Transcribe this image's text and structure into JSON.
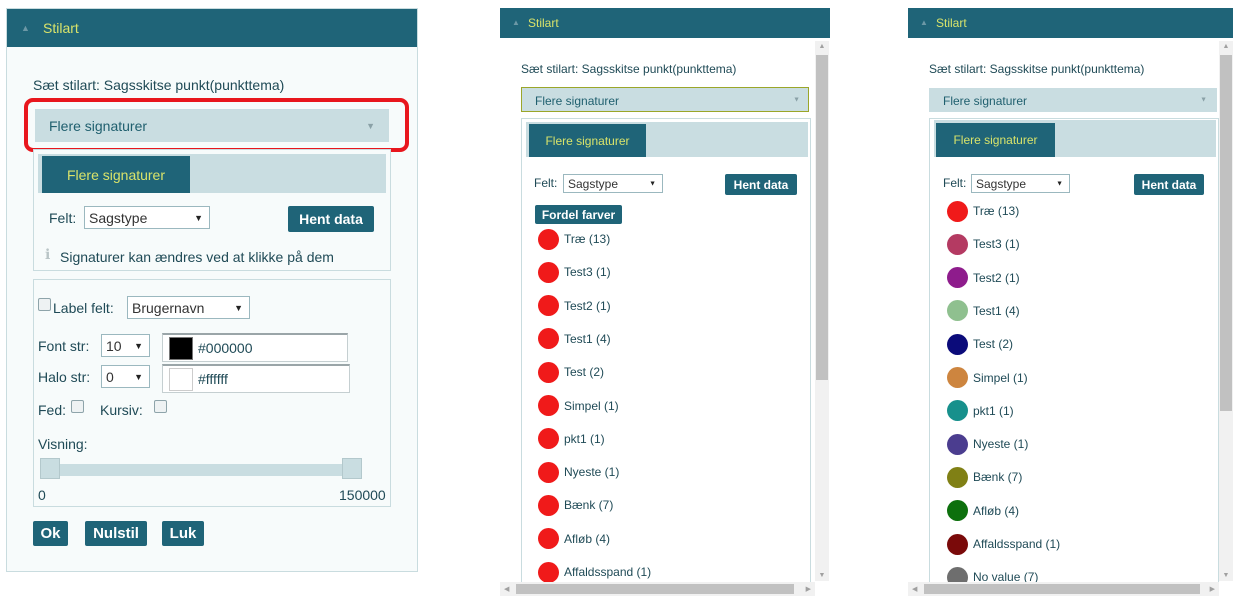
{
  "panel1": {
    "header_title": "Stilart",
    "set_style": "Sæt stilart: Sagsskitse punkt(punkttema)",
    "dropdown_value": "Flere signaturer",
    "tab_label": "Flere signaturer",
    "felt_label": "Felt:",
    "felt_value": "Sagstype",
    "hent_data": "Hent data",
    "info_text": "Signaturer kan ændres ved at klikke på dem",
    "label_felt": "Label felt:",
    "label_felt_value": "Brugernavn",
    "font_str_label": "Font str:",
    "font_str_value": "10",
    "font_color": "#000000",
    "halo_str_label": "Halo str:",
    "halo_str_value": "0",
    "halo_color": "#ffffff",
    "fed_label": "Fed:",
    "kursiv_label": "Kursiv:",
    "visning_label": "Visning:",
    "range_min": "0",
    "range_max": "150000",
    "buttons": {
      "ok": "Ok",
      "nulstil": "Nulstil",
      "luk": "Luk"
    }
  },
  "panel2": {
    "header_title": "Stilart",
    "set_style": "Sæt stilart: Sagsskitse punkt(punkttema)",
    "dropdown_value": "Flere signaturer",
    "tab_label": "Flere signaturer",
    "felt_label": "Felt:",
    "felt_value": "Sagstype",
    "hent_data": "Hent data",
    "fordel_farver": "Fordel farver",
    "items": [
      {
        "label": "Træ (13)",
        "color": "#f01a1a"
      },
      {
        "label": "Test3 (1)",
        "color": "#f01a1a"
      },
      {
        "label": "Test2 (1)",
        "color": "#f01a1a"
      },
      {
        "label": "Test1 (4)",
        "color": "#f01a1a"
      },
      {
        "label": "Test (2)",
        "color": "#f01a1a"
      },
      {
        "label": "Simpel (1)",
        "color": "#f01a1a"
      },
      {
        "label": "pkt1 (1)",
        "color": "#f01a1a"
      },
      {
        "label": "Nyeste (1)",
        "color": "#f01a1a"
      },
      {
        "label": "Bænk (7)",
        "color": "#f01a1a"
      },
      {
        "label": "Afløb (4)",
        "color": "#f01a1a"
      },
      {
        "label": "Affaldsspand (1)",
        "color": "#f01a1a"
      }
    ]
  },
  "panel3": {
    "header_title": "Stilart",
    "set_style": "Sæt stilart: Sagsskitse punkt(punkttema)",
    "dropdown_value": "Flere signaturer",
    "tab_label": "Flere signaturer",
    "felt_label": "Felt:",
    "felt_value": "Sagstype",
    "hent_data": "Hent data",
    "items": [
      {
        "label": "Træ (13)",
        "color": "#f01a1a"
      },
      {
        "label": "Test3 (1)",
        "color": "#b43a62"
      },
      {
        "label": "Test2 (1)",
        "color": "#8e1c8c"
      },
      {
        "label": "Test1 (4)",
        "color": "#8fc08f"
      },
      {
        "label": "Test (2)",
        "color": "#0b0b7a"
      },
      {
        "label": "Simpel (1)",
        "color": "#cd853f"
      },
      {
        "label": "pkt1 (1)",
        "color": "#17908c"
      },
      {
        "label": "Nyeste (1)",
        "color": "#4b3d8f"
      },
      {
        "label": "Bænk (7)",
        "color": "#808015"
      },
      {
        "label": "Afløb (4)",
        "color": "#0d700d"
      },
      {
        "label": "Affaldsspand (1)",
        "color": "#7a0a0a"
      },
      {
        "label": "No value (7)",
        "color": "#6e6e6e"
      }
    ]
  },
  "theme": {
    "header_bg": "#1f6478",
    "header_text": "#d9e36a",
    "accent_light": "#c9dde1",
    "highlight_border": "#e8161d"
  }
}
